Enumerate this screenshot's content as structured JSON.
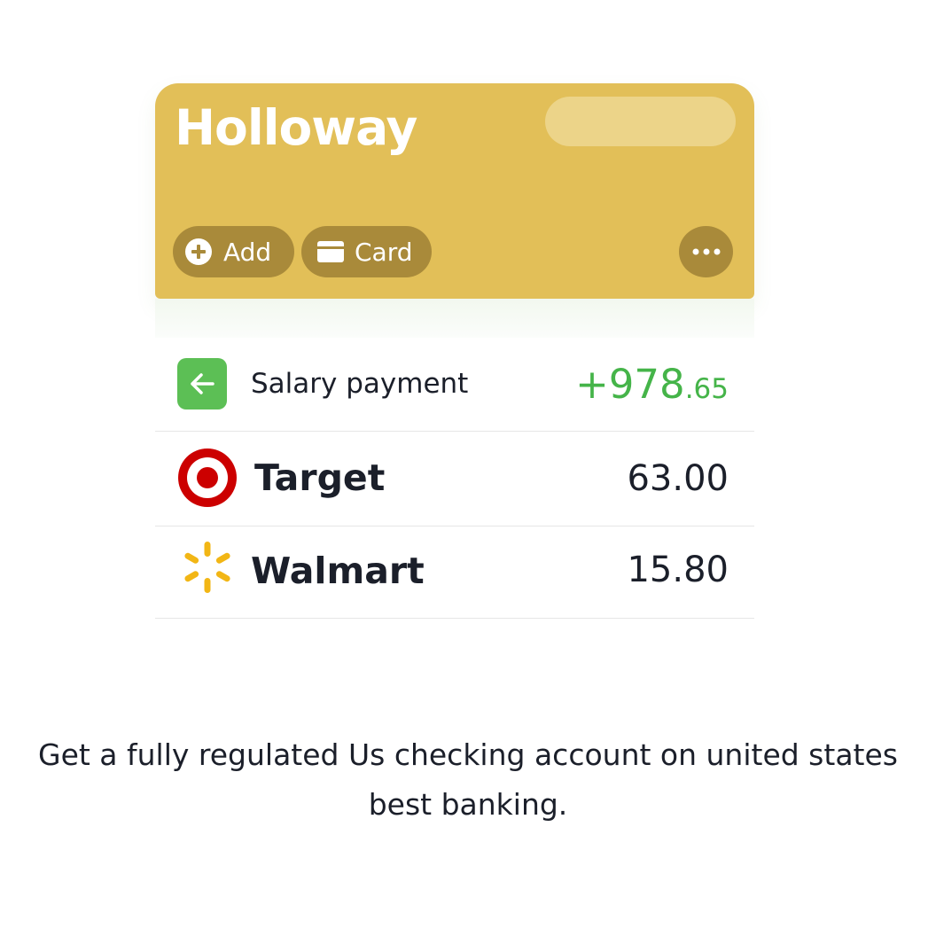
{
  "account": {
    "name": "Holloway",
    "actions": {
      "add_label": "Add",
      "card_label": "Card"
    }
  },
  "transactions": [
    {
      "name": "Salary payment",
      "amount_main": "+978",
      "amount_cents": ".65",
      "icon": "arrow-left-icon",
      "color": "#45b449"
    },
    {
      "name": "Target",
      "amount": "63.00",
      "icon": "target-logo"
    },
    {
      "name": "Walmart",
      "amount": "15.80",
      "icon": "walmart-spark-logo"
    }
  ],
  "tagline": "Get a fully regulated Us checking account on united states\nbest banking.",
  "colors": {
    "card": "#e2bf58",
    "chip": "#a98a3a",
    "positive": "#45b449",
    "target_red": "#cc0000",
    "walmart_yellow": "#f2b615"
  }
}
